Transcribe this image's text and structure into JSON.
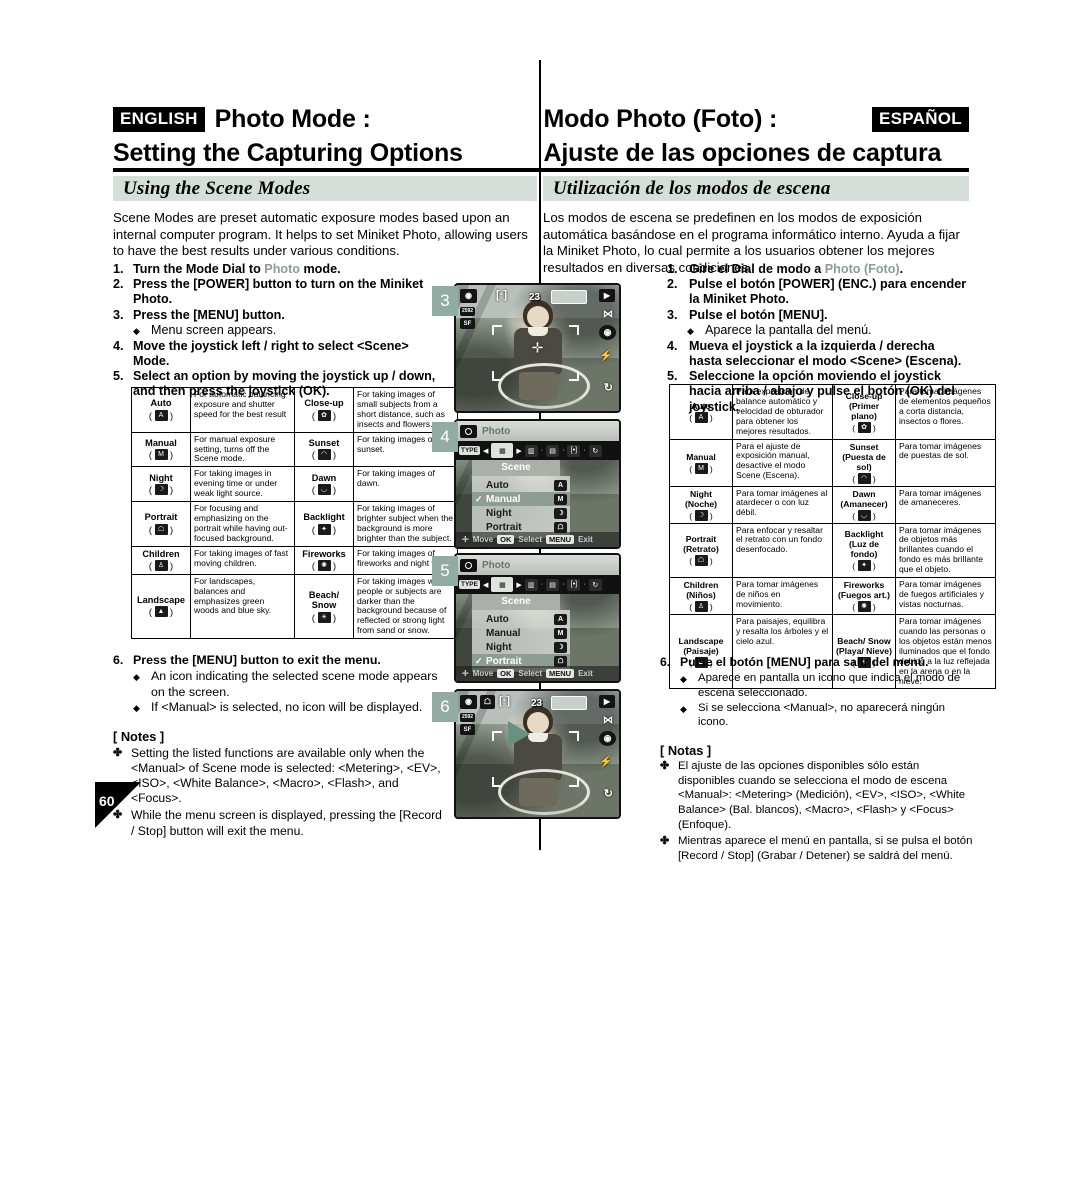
{
  "page_number": "60",
  "header": {
    "english_badge": "ENGLISH",
    "spanish_badge": "ESPAÑOL",
    "en_title_line1": "Photo Mode :",
    "en_title_line2": "Setting the Capturing Options",
    "es_title_line1": "Modo Photo (Foto) :",
    "es_title_line2": "Ajuste de las opciones de captura"
  },
  "section": {
    "en_title": "Using the Scene Modes",
    "es_title": "Utilización de los modos de escena"
  },
  "intro": {
    "en": "Scene Modes are preset automatic exposure modes based upon an internal computer program. It helps to set Miniket Photo, allowing users to have the best results under various conditions.",
    "es": "Los modos de escena se predefinen en los modos de exposición automática basándose en el programa informático interno. Ayuda a fijar la Miniket Photo, lo cual permite a los usuarios obtener los mejores resultados en diversas condiciones."
  },
  "steps_en": [
    {
      "num": "1.",
      "pre": "Turn the Mode Dial to ",
      "grey": "Photo",
      "post": " mode."
    },
    {
      "num": "2.",
      "pre": "Press the [POWER] button to turn on the Miniket Photo.",
      "grey": "",
      "post": ""
    },
    {
      "num": "3.",
      "pre": "Press the [MENU] button.",
      "grey": "",
      "post": ""
    },
    {
      "num": "4.",
      "pre": "Move the joystick left / right to select <Scene> Mode.",
      "grey": "",
      "post": ""
    },
    {
      "num": "5.",
      "pre": "Select an option by moving the joystick up / down, and then press the joystick (OK).",
      "grey": "",
      "post": ""
    }
  ],
  "step3_sub_en": "Menu screen appears.",
  "steps_es": [
    {
      "num": "1.",
      "pre": "Gire el Dial de modo a ",
      "grey": "Photo (Foto)",
      "post": "."
    },
    {
      "num": "2.",
      "pre": "Pulse el botón [POWER] (ENC.) para encender la Miniket Photo.",
      "grey": "",
      "post": ""
    },
    {
      "num": "3.",
      "pre": "Pulse el botón [MENU].",
      "grey": "",
      "post": ""
    },
    {
      "num": "4.",
      "pre": "Mueva el joystick a la izquierda / derecha hasta seleccionar el modo <Scene> (Escena).",
      "grey": "",
      "post": ""
    },
    {
      "num": "5.",
      "pre": "Seleccione la opción moviendo el joystick hacia arriba / abajo y pulse el botón (OK) del joystick.",
      "grey": "",
      "post": ""
    }
  ],
  "step3_sub_es": "Aparece la pantalla del menú.",
  "table_en": [
    {
      "name_l": "Auto",
      "icon_l": "auto-scene-icon",
      "desc_l": "For automatic balancing exposure and shutter speed for the best result",
      "name_r": "Close-up",
      "icon_r": "closeup-scene-icon",
      "desc_r": "For taking images of small subjects from a short distance, such as insects and flowers."
    },
    {
      "name_l": "Manual",
      "icon_l": "manual-scene-icon",
      "desc_l": "For manual exposure setting, turns off the Scene mode.",
      "name_r": "Sunset",
      "icon_r": "sunset-scene-icon",
      "desc_r": "For taking images of sunset."
    },
    {
      "name_l": "Night",
      "icon_l": "night-scene-icon",
      "desc_l": "For taking images in evening time or under weak light source.",
      "name_r": "Dawn",
      "icon_r": "dawn-scene-icon",
      "desc_r": "For taking images of dawn."
    },
    {
      "name_l": "Portrait",
      "icon_l": "portrait-scene-icon",
      "desc_l": "For focusing and emphasizing on the portrait while having out-focused background.",
      "name_r": "Backlight",
      "icon_r": "backlight-scene-icon",
      "desc_r": "For taking images of brighter subject when the background is more brighter than the subject."
    },
    {
      "name_l": "Children",
      "icon_l": "children-scene-icon",
      "desc_l": "For taking images of fast moving children.",
      "name_r": "Fireworks",
      "icon_r": "fireworks-scene-icon",
      "desc_r": "For taking images of fireworks and night view."
    },
    {
      "name_l": "Landscape",
      "icon_l": "landscape-scene-icon",
      "desc_l": "For landscapes, balances and emphasizes green woods and blue sky.",
      "name_r": "Beach/ Snow",
      "icon_r": "beach-snow-scene-icon",
      "desc_r": "For taking images when people or subjects are darker than the background because of reflected or strong light from sand or snow."
    }
  ],
  "table_es": [
    {
      "name_l": "Auto",
      "icon_l": "auto-scene-icon",
      "desc_l": "Para exposición de balance automático y velocidad de obturador para obtener los mejores resultados.",
      "name_r": "Close-up (Primer plano)",
      "icon_r": "closeup-scene-icon",
      "desc_r": "Para tomar imágenes de elementos pequeños a corta distancia, insectos o flores."
    },
    {
      "name_l": "Manual",
      "icon_l": "manual-scene-icon",
      "desc_l": "Para el ajuste de exposición manual, desactive el modo Scene (Escena).",
      "name_r": "Sunset (Puesta de sol)",
      "icon_r": "sunset-scene-icon",
      "desc_r": "Para tomar imágenes de puestas de sol."
    },
    {
      "name_l": "Night (Noche)",
      "icon_l": "night-scene-icon",
      "desc_l": "Para tomar imágenes al atardecer o con luz débil.",
      "name_r": "Dawn (Amanecer)",
      "icon_r": "dawn-scene-icon",
      "desc_r": "Para tomar imágenes de amaneceres."
    },
    {
      "name_l": "Portrait (Retrato)",
      "icon_l": "portrait-scene-icon",
      "desc_l": "Para enfocar y resaltar el retrato con un fondo desenfocado.",
      "name_r": "Backlight (Luz de fondo)",
      "icon_r": "backlight-scene-icon",
      "desc_r": "Para tomar imágenes de objetos más brillantes cuando el fondo es más brillante que el objeto."
    },
    {
      "name_l": "Children (Niños)",
      "icon_l": "children-scene-icon",
      "desc_l": "Para tomar imágenes de niños en movimiento.",
      "name_r": "Fireworks (Fuegos art.)",
      "icon_r": "fireworks-scene-icon",
      "desc_r": "Para tomar imágenes de fuegos artificiales y vistas nocturnas."
    },
    {
      "name_l": "Landscape (Paisaje)",
      "icon_l": "landscape-scene-icon",
      "desc_l": "Para paisajes, equilibra y resalta los árboles y el cielo azul.",
      "name_r": "Beach/ Snow (Playa/ Nieve)",
      "icon_r": "beach-snow-scene-icon",
      "desc_r": "Para tomar imágenes cuando las personas o los objetos están menos iluminados que el fondo debido a la luz reflejada en la arena o en la nieve."
    }
  ],
  "step6_en": {
    "num": "6.",
    "text": "Press the [MENU] button to exit the menu."
  },
  "step6_subs_en": [
    "An icon indicating the selected scene mode appears on the screen.",
    "If <Manual> is selected, no icon will be displayed."
  ],
  "step6_es": {
    "num": "6.",
    "text": "Pulse el botón [MENU] para salir del menú."
  },
  "step6_subs_es": [
    "Aparece en pantalla un icono que indica el modo de escena seleccionado.",
    "Si se selecciona <Manual>, no aparecerá ningún icono."
  ],
  "notes_en_title": "[ Notes ]",
  "notes_en": [
    "Setting the listed functions are available only when the <Manual> of Scene mode is selected: <Metering>, <EV>, <ISO>, <White Balance>, <Macro>, <Flash>, and <Focus>.",
    "While the menu screen is displayed, pressing the [Record / Stop] button will exit the menu."
  ],
  "notes_es_title": "[ Notas ]",
  "notes_es": [
    "El ajuste de las opciones disponibles sólo están disponibles cuando se selecciona el modo de escena <Manual>: <Metering> (Medición), <EV>, <ISO>, <White Balance> (Bal. blancos), <Macro>, <Flash> y <Focus> (Enfoque).",
    "Mientras aparece el menú en pantalla, si se pulsa el botón [Record / Stop] (Grabar / Detener) se saldrá del menú."
  ],
  "screens": {
    "shot3": {
      "badge": "3",
      "counter": "23",
      "memory": "IN",
      "resolution": "2592",
      "quality": "SF",
      "icons": [
        "camera-mode-icon",
        "focus-frame-icon",
        "memory-in-icon",
        "battery-icon",
        "playback-icon",
        "macro-icon",
        "redeye-icon",
        "flash-off-icon",
        "self-timer-icon"
      ]
    },
    "shot4": {
      "badge": "4",
      "title": "Photo",
      "submenu": "Scene",
      "tab_type": "TYPE",
      "items": [
        {
          "label": "Auto",
          "selected": false,
          "checked": false,
          "icon": "auto-scene-icon"
        },
        {
          "label": "Manual",
          "selected": true,
          "checked": true,
          "icon": "manual-scene-icon"
        },
        {
          "label": "Night",
          "selected": false,
          "checked": false,
          "icon": "night-scene-icon"
        },
        {
          "label": "Portrait",
          "selected": false,
          "checked": false,
          "icon": "portrait-scene-icon"
        }
      ],
      "foot_move": "Move",
      "foot_ok": "OK",
      "foot_select": "Select",
      "foot_menu": "MENU",
      "foot_exit": "Exit"
    },
    "shot5": {
      "badge": "5",
      "title": "Photo",
      "submenu": "Scene",
      "tab_type": "TYPE",
      "items": [
        {
          "label": "Auto",
          "selected": false,
          "checked": false,
          "icon": "auto-scene-icon"
        },
        {
          "label": "Manual",
          "selected": false,
          "checked": false,
          "icon": "manual-scene-icon"
        },
        {
          "label": "Night",
          "selected": false,
          "checked": false,
          "icon": "night-scene-icon"
        },
        {
          "label": "Portrait",
          "selected": true,
          "checked": true,
          "icon": "portrait-scene-icon"
        }
      ],
      "foot_move": "Move",
      "foot_ok": "OK",
      "foot_select": "Select",
      "foot_menu": "MENU",
      "foot_exit": "Exit"
    },
    "shot6": {
      "badge": "6",
      "counter": "23",
      "memory": "IN",
      "resolution": "2592",
      "quality": "SF",
      "icons": [
        "camera-mode-icon",
        "portrait-scene-icon",
        "focus-frame-icon",
        "memory-in-icon",
        "battery-icon",
        "playback-icon",
        "macro-icon",
        "redeye-icon",
        "flash-off-icon",
        "self-timer-icon"
      ]
    }
  },
  "colors": {
    "section_bar": "#d6ded9",
    "step_badge": "#93aca3",
    "grey_word": "#8c9a9a"
  }
}
